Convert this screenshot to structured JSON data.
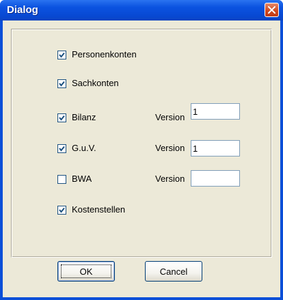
{
  "window": {
    "title": "Dialog",
    "close_icon": "close-icon"
  },
  "options": [
    {
      "label": "Personenkonten",
      "checked": true
    },
    {
      "label": "Sachkonten",
      "checked": true
    },
    {
      "label": "Bilanz",
      "checked": true,
      "version_label": "Version",
      "version_value": "1"
    },
    {
      "label": "G.u.V.",
      "checked": true,
      "version_label": "Version",
      "version_value": "1"
    },
    {
      "label": "BWA",
      "checked": false,
      "version_label": "Version",
      "version_value": ""
    },
    {
      "label": "Kostenstellen",
      "checked": true
    }
  ],
  "buttons": {
    "ok_label": "OK",
    "cancel_label": "Cancel"
  },
  "colors": {
    "titlebar": "#0b53e0",
    "close_button": "#d24a1f",
    "dialog_bg": "#ece9d8",
    "checkmark": "#1c5180"
  }
}
